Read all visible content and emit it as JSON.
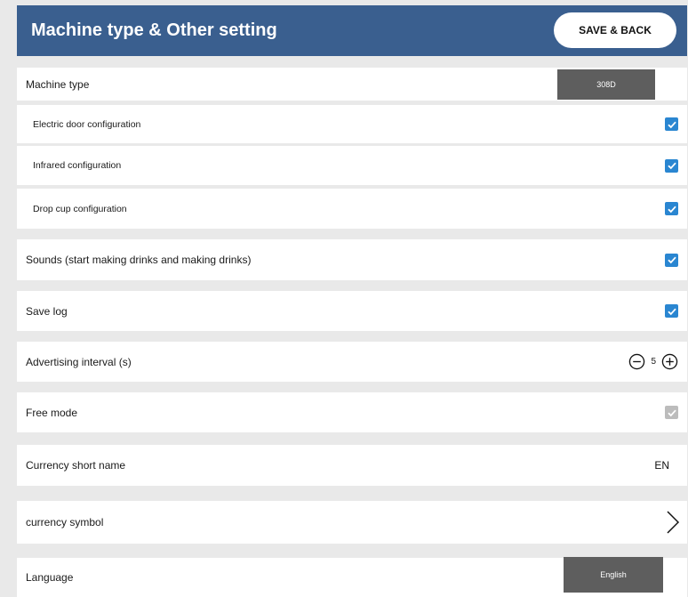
{
  "header": {
    "title": "Machine type & Other setting",
    "save_label": "SAVE & BACK"
  },
  "machine_type": {
    "label": "Machine type",
    "value": "308D"
  },
  "config_items": [
    {
      "label": "Electric door configuration",
      "checked": true
    },
    {
      "label": "Infrared configuration",
      "checked": true
    },
    {
      "label": "Drop cup configuration",
      "checked": true
    }
  ],
  "sounds": {
    "label": "Sounds (start making drinks and making drinks)",
    "checked": true
  },
  "save_log": {
    "label": "Save log",
    "checked": true
  },
  "advertising": {
    "label": "Advertising interval (s)",
    "value": "5"
  },
  "free_mode": {
    "label": "Free mode",
    "checked": true,
    "disabled": true
  },
  "currency_short": {
    "label": "Currency short name",
    "value": "EN"
  },
  "currency_symbol": {
    "label": "currency symbol"
  },
  "language": {
    "label": "Language",
    "value": "English"
  },
  "colors": {
    "header": "#3a5f8f",
    "checkbox": "#2a86d1",
    "select_bg": "#5e5e5e",
    "page_bg": "#e9e9e9"
  }
}
